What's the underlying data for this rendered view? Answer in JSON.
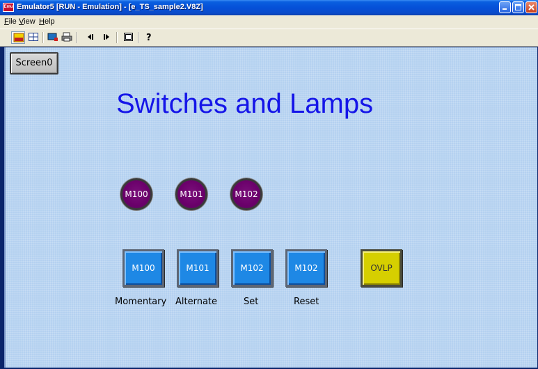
{
  "window": {
    "icon_text": "Emu",
    "title": "Emulator5 [RUN - Emulation] - [e_TS_sample2.V8Z]"
  },
  "menu": {
    "items": [
      "File",
      "View",
      "Help"
    ],
    "underline_first": [
      "F",
      "V",
      "H"
    ],
    "rest": [
      "ile",
      "iew",
      "elp"
    ]
  },
  "toolbar": {
    "icons": [
      "run-icon",
      "grid-icon",
      "monitor-icon",
      "print-icon",
      "previous-icon",
      "next-icon",
      "screen-list-icon",
      "help-icon"
    ]
  },
  "screen": {
    "screen_button": "Screen0",
    "heading": "Switches and Lamps",
    "lamps": [
      "M100",
      "M101",
      "M102"
    ],
    "switches": [
      "M100",
      "M101",
      "M102",
      "M102"
    ],
    "switch_labels": [
      "Momentary",
      "Alternate",
      "Set",
      "Reset"
    ],
    "ovlp_button": "OVLP",
    "colors": {
      "background": "#b4d1f0",
      "heading": "#1515e8",
      "lamp": "#6a006a",
      "switch": "#1e88e5",
      "ovlp": "#d6cf00"
    }
  }
}
